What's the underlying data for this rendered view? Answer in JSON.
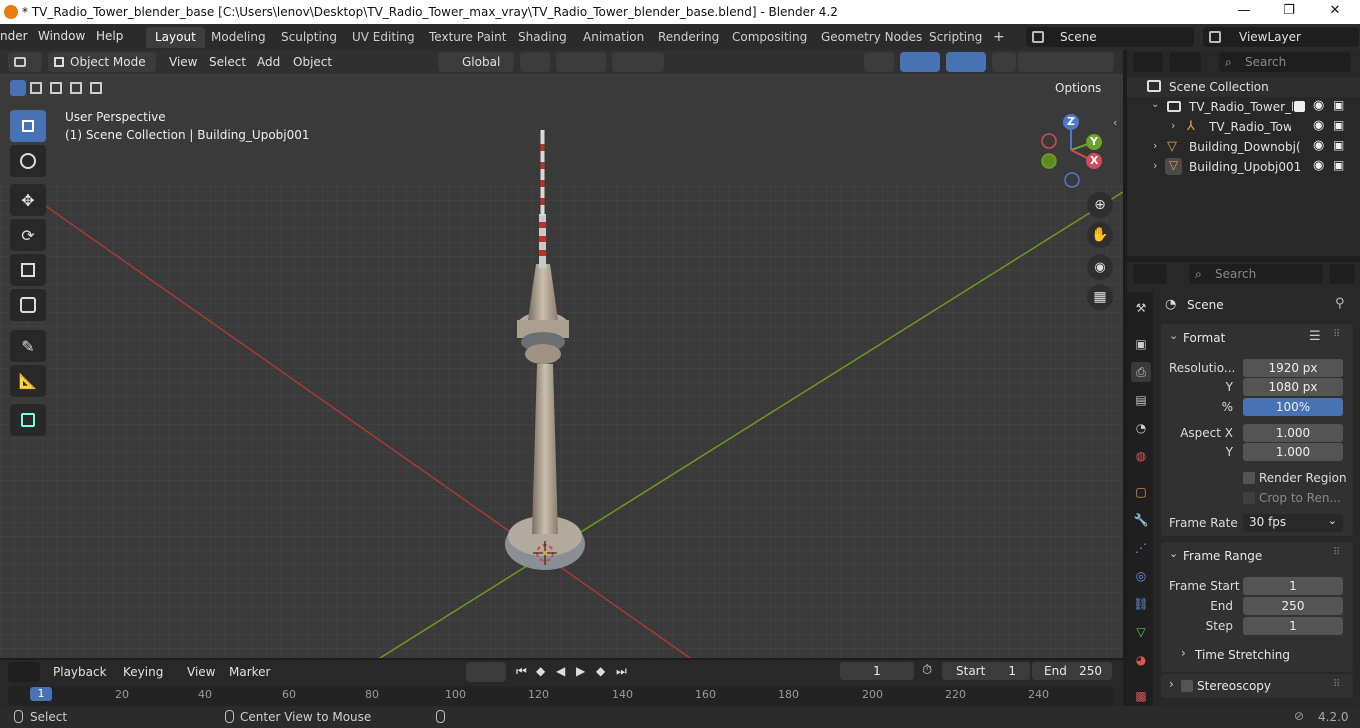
{
  "titlebar": {
    "title": "* TV_Radio_Tower_blender_base [C:\\Users\\lenov\\Desktop\\TV_Radio_Tower_max_vray\\TV_Radio_Tower_blender_base.blend] - Blender 4.2",
    "minimize": "—",
    "maximize": "❐",
    "close": "✕"
  },
  "menubar": {
    "menus": [
      "nder",
      "Window",
      "Help"
    ],
    "workspaces": [
      "Layout",
      "Modeling",
      "Sculpting",
      "UV Editing",
      "Texture Paint",
      "Shading",
      "Animation",
      "Rendering",
      "Compositing",
      "Geometry Nodes",
      "Scripting"
    ],
    "active_workspace": "Layout",
    "add_tab": "+",
    "scene": "Scene",
    "view_layer": "ViewLayer"
  },
  "viewport_header": {
    "mode": "Object Mode",
    "menus": [
      "View",
      "Select",
      "Add",
      "Object"
    ],
    "orientation": "Global",
    "options": "Options"
  },
  "viewport": {
    "perspective": "User Perspective",
    "collection_info": "(1) Scene Collection | Building_Upobj001",
    "gizmo": {
      "z": "Z",
      "y": "Y",
      "x": "X"
    }
  },
  "outliner": {
    "search_placeholder": "Search",
    "root": "Scene Collection",
    "items": [
      {
        "label": "TV_Radio_Tower_la"
      },
      {
        "label": "TV_Radio_Towe"
      },
      {
        "label": "Building_Downobj("
      },
      {
        "label": "Building_Upobj001"
      }
    ]
  },
  "properties": {
    "search_placeholder": "Search",
    "context": "Scene",
    "format": {
      "title": "Format",
      "resolution_label": "Resolutio...",
      "resolution_x": "1920 px",
      "y_label": "Y",
      "resolution_y": "1080 px",
      "percent_label": "%",
      "percent": "100%",
      "percent_value": 1.0,
      "aspect_x_label": "Aspect X",
      "aspect_x": "1.000",
      "aspect_y_label": "Y",
      "aspect_y": "1.000",
      "render_region": "Render Region",
      "crop": "Crop to Ren...",
      "frame_rate_label": "Frame Rate",
      "frame_rate": "30 fps"
    },
    "frame_range": {
      "title": "Frame Range",
      "start_label": "Frame Start",
      "start": "1",
      "end_label": "End",
      "end": "250",
      "step_label": "Step",
      "step": "1",
      "time_stretching": "Time Stretching"
    },
    "stereoscopy": "Stereoscopy"
  },
  "timeline": {
    "menus": [
      "Playback",
      "Keying",
      "View",
      "Marker"
    ],
    "current_frame": "1",
    "start_label": "Start",
    "start": "1",
    "end_label": "End",
    "end": "250",
    "ticks": [
      "1",
      "20",
      "40",
      "60",
      "80",
      "100",
      "120",
      "140",
      "160",
      "180",
      "200",
      "220",
      "240"
    ]
  },
  "statusbar": {
    "select": "Select",
    "center_view": "Center View to Mouse",
    "version": "4.2.0"
  },
  "colors": {
    "accent": "#4772b3",
    "x_axis": "#a63a3a",
    "y_axis": "#6f9a1f"
  }
}
